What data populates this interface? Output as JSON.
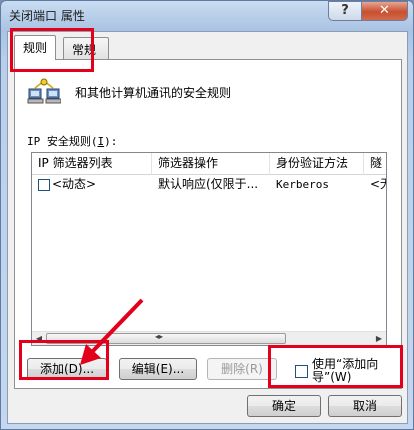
{
  "window": {
    "title": "关闭端口 属性",
    "help_label": "?",
    "close_label": "✕"
  },
  "tabs": [
    {
      "label": "规则",
      "selected": true
    },
    {
      "label": "常规",
      "selected": false
    }
  ],
  "rules_panel": {
    "description": "和其他计算机通讯的安全规则",
    "list_label_prefix": "IP 安全规则(",
    "list_label_accel": "I",
    "list_label_suffix": "):",
    "columns": [
      "IP 筛选器列表",
      "筛选器操作",
      "身份验证方法",
      "隧"
    ],
    "rows": [
      {
        "checked": false,
        "cells": [
          "<动态>",
          "默认响应(仅限于...",
          "Kerberos",
          "<无"
        ]
      }
    ]
  },
  "buttons": {
    "add": "添加(D)...",
    "edit": "编辑(E)...",
    "delete": "删除(R)",
    "ok": "确定",
    "cancel": "取消"
  },
  "wizard_checkbox": {
    "label": "使用“添加向导”(W)",
    "checked": false
  },
  "colors": {
    "highlight": "#e2001a",
    "accent": "#c7502f"
  }
}
